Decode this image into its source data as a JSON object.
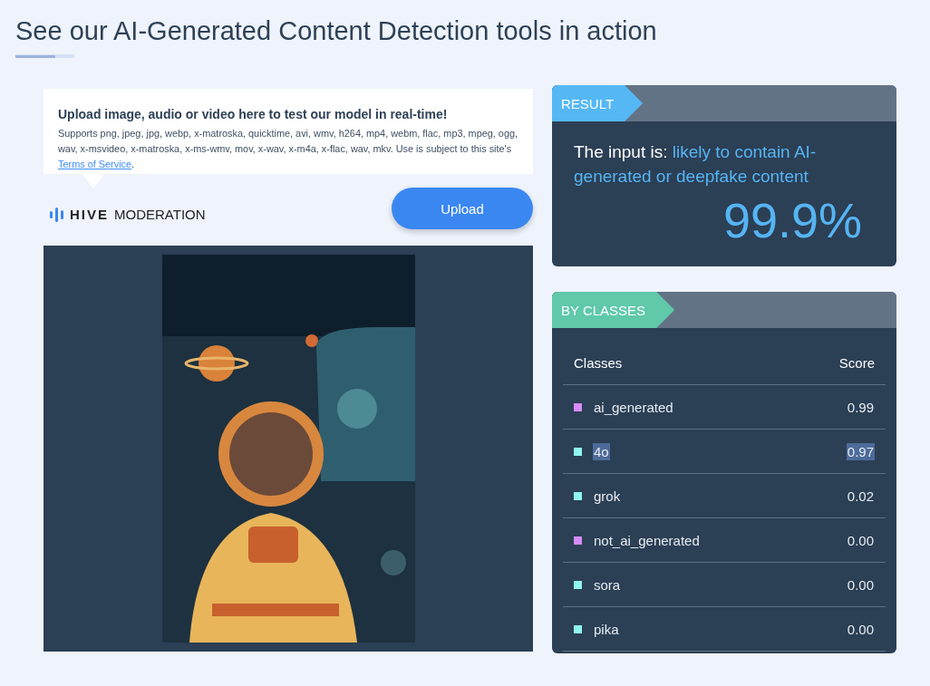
{
  "heading": "See our AI-Generated Content Detection tools in action",
  "upload": {
    "title": "Upload image, audio or video here to test our model in real-time!",
    "description": "Supports png, jpeg, jpg, webp, x-matroska, quicktime, avi, wmv, h264, mp4, webm, flac, mp3, mpeg, ogg, wav, x-msvideo, x-matroska, x-ms-wmv, mov, x-wav, x-m4a, x-flac, wav, mkv. Use is subject to this site's ",
    "link": "Terms of Service",
    "after_link": ".",
    "brand_bold": "HIVE",
    "brand_rest": "MODERATION",
    "button": "Upload"
  },
  "result": {
    "tag": "RESULT",
    "prefix": "The input is: ",
    "verdict": "likely to contain AI-generated or deepfake content",
    "score": "99.9%"
  },
  "classes": {
    "tag": "BY CLASSES",
    "columns": [
      "Classes",
      "Score"
    ],
    "rows": [
      {
        "name": "ai_generated",
        "score": "0.99",
        "color": "#d68cf7",
        "highlighted": false
      },
      {
        "name": "4o",
        "score": "0.97",
        "color": "#8ff5ef",
        "highlighted": true
      },
      {
        "name": "grok",
        "score": "0.02",
        "color": "#8ff5ef",
        "highlighted": false
      },
      {
        "name": "not_ai_generated",
        "score": "0.00",
        "color": "#d68cf7",
        "highlighted": false
      },
      {
        "name": "sora",
        "score": "0.00",
        "color": "#8ff5ef",
        "highlighted": false
      },
      {
        "name": "pika",
        "score": "0.00",
        "color": "#8ff5ef",
        "highlighted": false
      }
    ]
  }
}
